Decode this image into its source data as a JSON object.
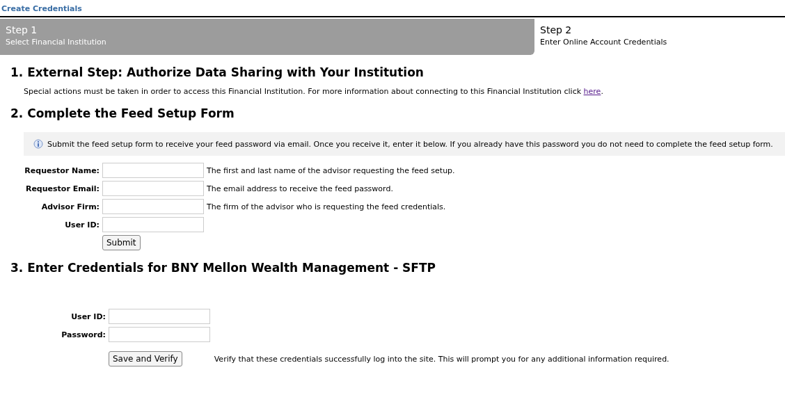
{
  "page_title": "Create Credentials",
  "steps": [
    {
      "title": "Step 1",
      "subtitle": "Select Financial Institution",
      "selected": false
    },
    {
      "title": "Step 2",
      "subtitle": "Enter Online Account Credentials",
      "selected": true
    }
  ],
  "section_1": {
    "heading": "1. External Step: Authorize Data Sharing with Your Institution",
    "text": "Special actions must be taken in order to access this Financial Institution. For more information about connecting to this Financial Institution click ",
    "link": "here",
    "after_link": "."
  },
  "section_2": {
    "heading": "2. Complete the Feed Setup Form",
    "info": "Submit the feed setup form to receive your feed password via email. Once you receive it, enter it below. If you already have this password you do not need to complete the feed setup form.",
    "fields": [
      {
        "label": "Requestor Name:",
        "hint": "The first and last name of the advisor requesting the feed setup."
      },
      {
        "label": "Requestor Email:",
        "hint": "The email address to receive the feed password."
      },
      {
        "label": "Advisor Firm:",
        "hint": "The firm of the advisor who is requesting the feed credentials."
      },
      {
        "label": "User ID:"
      }
    ],
    "button": "Submit"
  },
  "section_3": {
    "heading": "3. Enter Credentials for BNY Mellon Wealth Management - SFTP",
    "fields": [
      {
        "label": "User ID:"
      },
      {
        "label": "Password:"
      }
    ],
    "button": "Save and Verify",
    "button_note": "Verify that these credentials successfully log into the site. This will prompt you for any additional information required."
  }
}
